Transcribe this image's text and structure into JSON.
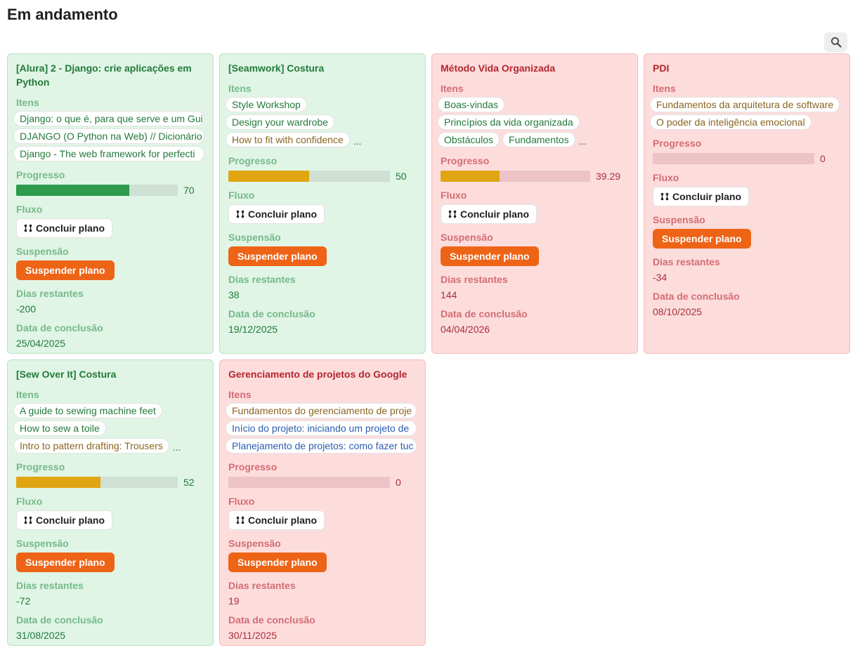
{
  "page": {
    "title": "Em andamento"
  },
  "toolbar": {
    "search_icon": "search-icon"
  },
  "labels": {
    "items": "Itens",
    "progress": "Progresso",
    "flow": "Fluxo",
    "suspension": "Suspensão",
    "days_left": "Dias restantes",
    "completion_date": "Data de conclusão",
    "complete_plan": "Concluir plano",
    "suspend_plan": "Suspender plano",
    "more": "..."
  },
  "colors": {
    "green_card": "#e0f5e5",
    "red_card": "#fddcdc",
    "progress_green": "#2e9a4c",
    "progress_amber": "#e0a611",
    "suspend_button": "#ee6417"
  },
  "cards": [
    {
      "title": "[Alura] 2 - Django: crie aplicações em Python",
      "status": "green",
      "items": [
        {
          "label": "Django: o que é, para que serve e um Gui",
          "color": "green"
        },
        {
          "label": "DJANGO (O Python na Web) // Dicionário",
          "color": "green"
        },
        {
          "label": "Django - The web framework for perfecti",
          "color": "green"
        }
      ],
      "progress": 70,
      "progress_label": "70",
      "days_left": "-200",
      "completion_date": "25/04/2025"
    },
    {
      "title": "[Seamwork] Costura",
      "status": "green",
      "items": [
        {
          "label": "Style Workshop",
          "color": "green"
        },
        {
          "label": "Design your wardrobe",
          "color": "green"
        },
        {
          "label": "How to fit with confidence",
          "color": "brown"
        }
      ],
      "progress": 50,
      "progress_label": "50",
      "days_left": "38",
      "completion_date": "19/12/2025"
    },
    {
      "title": "Método Vida Organizada",
      "status": "red",
      "items": [
        {
          "label": "Boas-vindas",
          "color": "green"
        },
        {
          "label": "Princípios da vida organizada",
          "color": "green"
        },
        {
          "label": "Obstáculos",
          "color": "green"
        },
        {
          "label": "Fundamentos",
          "color": "green"
        }
      ],
      "progress": 39.29,
      "progress_label": "39.29",
      "days_left": "144",
      "completion_date": "04/04/2026"
    },
    {
      "title": "PDI",
      "status": "red",
      "items": [
        {
          "label": "Fundamentos da arquitetura de software",
          "color": "brown"
        },
        {
          "label": "O poder da inteligência emocional",
          "color": "brown"
        }
      ],
      "progress": 0,
      "progress_label": "0",
      "days_left": "-34",
      "completion_date": "08/10/2025"
    },
    {
      "title": "[Sew Over It] Costura",
      "status": "green",
      "items": [
        {
          "label": "A guide to sewing machine feet",
          "color": "green"
        },
        {
          "label": "How to sew a toile",
          "color": "green"
        },
        {
          "label": "Intro to pattern drafting: Trousers",
          "color": "brown"
        }
      ],
      "progress": 52,
      "progress_label": "52",
      "days_left": "-72",
      "completion_date": "31/08/2025"
    },
    {
      "title": "Gerenciamento de projetos do Google",
      "status": "red",
      "items": [
        {
          "label": "Fundamentos do gerenciamento de proje",
          "color": "brown"
        },
        {
          "label": "Início do projeto: iniciando um projeto de",
          "color": "blue"
        },
        {
          "label": "Planejamento de projetos: como fazer tuc",
          "color": "blue"
        }
      ],
      "progress": 0,
      "progress_label": "0",
      "days_left": "19",
      "completion_date": "30/11/2025"
    }
  ]
}
